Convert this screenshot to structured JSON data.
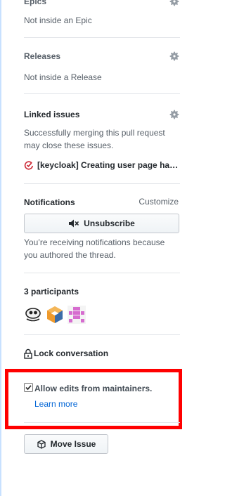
{
  "epics": {
    "heading": "Epics",
    "value": "Not inside an Epic"
  },
  "releases": {
    "heading": "Releases",
    "value": "Not inside a Release"
  },
  "linked_issues": {
    "heading": "Linked issues",
    "description": "Successfully merging this pull request may close these issues.",
    "issue_title": "[keycloak] Creating user page ha…"
  },
  "notifications": {
    "heading": "Notifications",
    "customize_label": "Customize",
    "unsubscribe_label": "Unsubscribe",
    "reason": "You’re receiving notifications because you authored the thread."
  },
  "participants": {
    "heading": "3 participants"
  },
  "lock": {
    "label": "Lock conversation"
  },
  "maintainer_edits": {
    "label": "Allow edits from maintainers.",
    "checked": true,
    "learn_more": "Learn more"
  },
  "move_issue": {
    "label": "Move Issue"
  },
  "colors": {
    "link": "#0366d6",
    "highlight": "#ff0000",
    "issue_closed": "#cb2431",
    "sidebar_rule": "#c8e1ff"
  }
}
